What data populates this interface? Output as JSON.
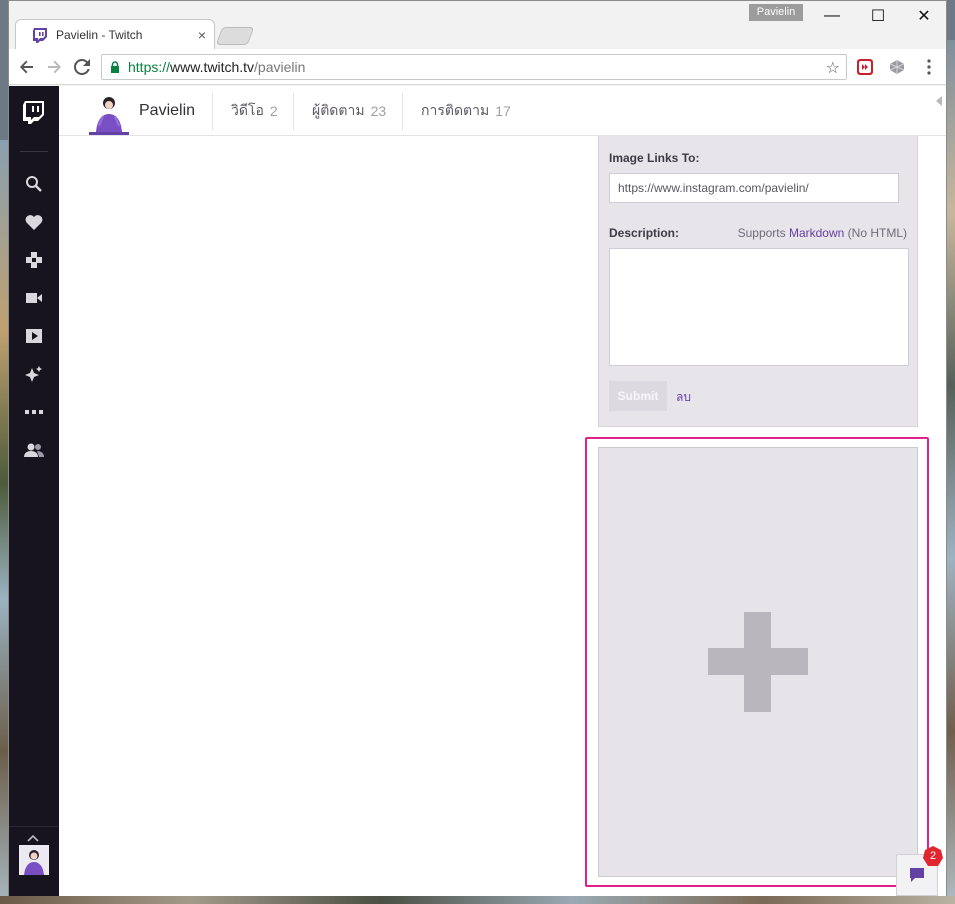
{
  "browser": {
    "tab_title": "Pavielin - Twitch",
    "tab_close": "×",
    "profile_name": "Pavielin",
    "url_scheme": "https://",
    "url_host": "www.twitch.tv",
    "url_path": "/pavielin",
    "controls": {
      "minimize": "—",
      "maximize": "☐",
      "close": "✕"
    },
    "icons": [
      "back-icon",
      "forward-icon",
      "reload-icon",
      "lock-icon",
      "star-icon",
      "extension-icon",
      "extension-icon-2",
      "menu-icon"
    ]
  },
  "sidebar": {
    "icons": [
      "twitch-logo-icon",
      "search-icon",
      "heart-icon",
      "games-icon",
      "video-icon",
      "play-icon",
      "sparkle-icon",
      "more-icon",
      "friends-icon"
    ],
    "collapse_label": "^"
  },
  "channel": {
    "name": "Pavielin",
    "tabs": [
      {
        "label": "วิดีโอ",
        "count": "2"
      },
      {
        "label": "ผู้ติดตาม",
        "count": "23"
      },
      {
        "label": "การติดตาม",
        "count": "17"
      }
    ]
  },
  "panel_form": {
    "image_link_label": "Image Links To:",
    "image_link_value": "https://www.instagram.com/pavielin/",
    "description_label": "Description:",
    "markdown_prefix": "Supports ",
    "markdown_link": "Markdown",
    "markdown_suffix": " (No HTML)",
    "description_value": "",
    "submit_label": "Submit",
    "delete_label": "ลบ"
  },
  "add_panel": {
    "icon": "plus-icon"
  },
  "whispers": {
    "badge": "2"
  },
  "colors": {
    "twitch_purple": "#6441a4",
    "highlight": "#e0218a",
    "sidebar": "#17141f",
    "badge": "#e0262f"
  }
}
